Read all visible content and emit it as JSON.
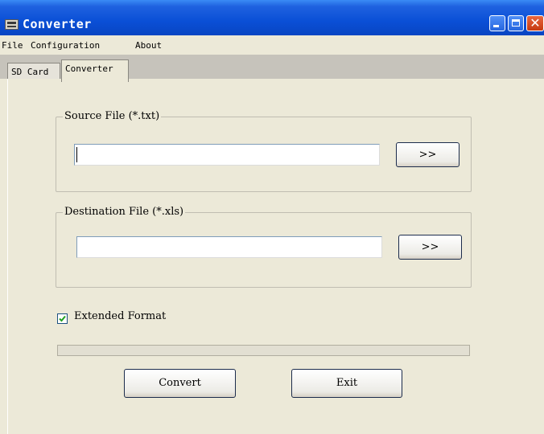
{
  "window": {
    "title": "Converter",
    "close_glyph": "✕",
    "icons": {
      "app": "app-window-icon",
      "minimize": "minimize-icon",
      "maximize": "maximize-icon",
      "close": "close-icon"
    }
  },
  "menu": [
    "File",
    "Configuration",
    "About"
  ],
  "tabs": [
    {
      "label": "SD Card",
      "active": false
    },
    {
      "label": "Converter",
      "active": true
    }
  ],
  "source": {
    "legend": "Source File (*.txt)",
    "value": "",
    "browse_label": ">>"
  },
  "destination": {
    "legend": "Destination File (*.xls)",
    "value": "",
    "browse_label": ">>"
  },
  "options": {
    "extended_format_label": "Extended Format",
    "extended_format_checked": true
  },
  "progress": {
    "value": 0
  },
  "actions": {
    "convert_label": "Convert",
    "exit_label": "Exit"
  },
  "colors": {
    "titlebar": "#0a4fd6",
    "window_bg": "#ece9d8",
    "tab_strip": "#c6c3bb",
    "close_button": "#c63a10"
  }
}
